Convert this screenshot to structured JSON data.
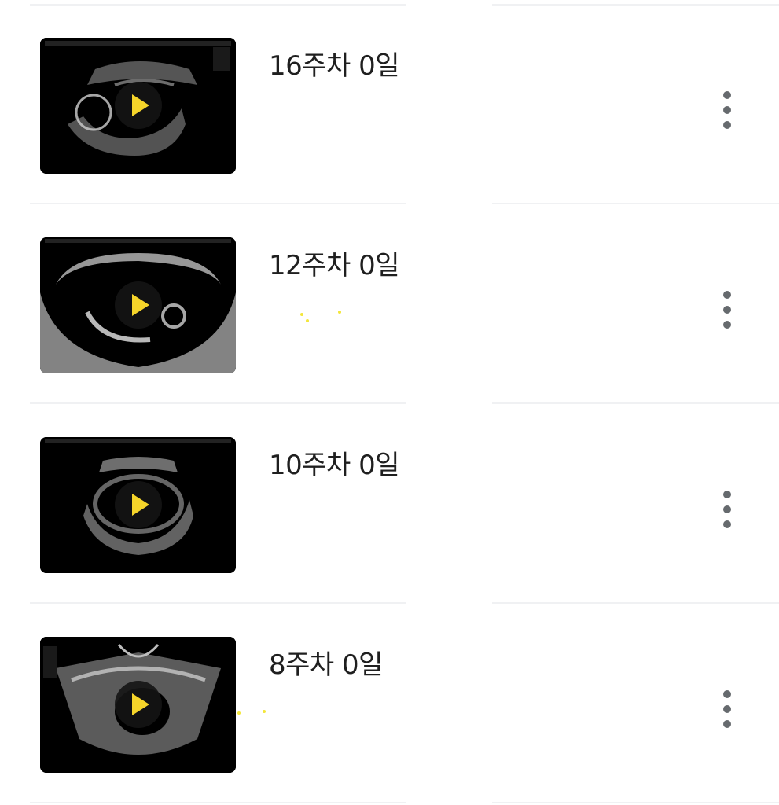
{
  "accent_color": "#f5d42a",
  "items": [
    {
      "title": "16주차 0일",
      "play_icon": "play-icon",
      "more_icon": "more-vertical-icon"
    },
    {
      "title": "12주차 0일",
      "play_icon": "play-icon",
      "more_icon": "more-vertical-icon"
    },
    {
      "title": "10주차 0일",
      "play_icon": "play-icon",
      "more_icon": "more-vertical-icon"
    },
    {
      "title": "8주차 0일",
      "play_icon": "play-icon",
      "more_icon": "more-vertical-icon"
    }
  ]
}
